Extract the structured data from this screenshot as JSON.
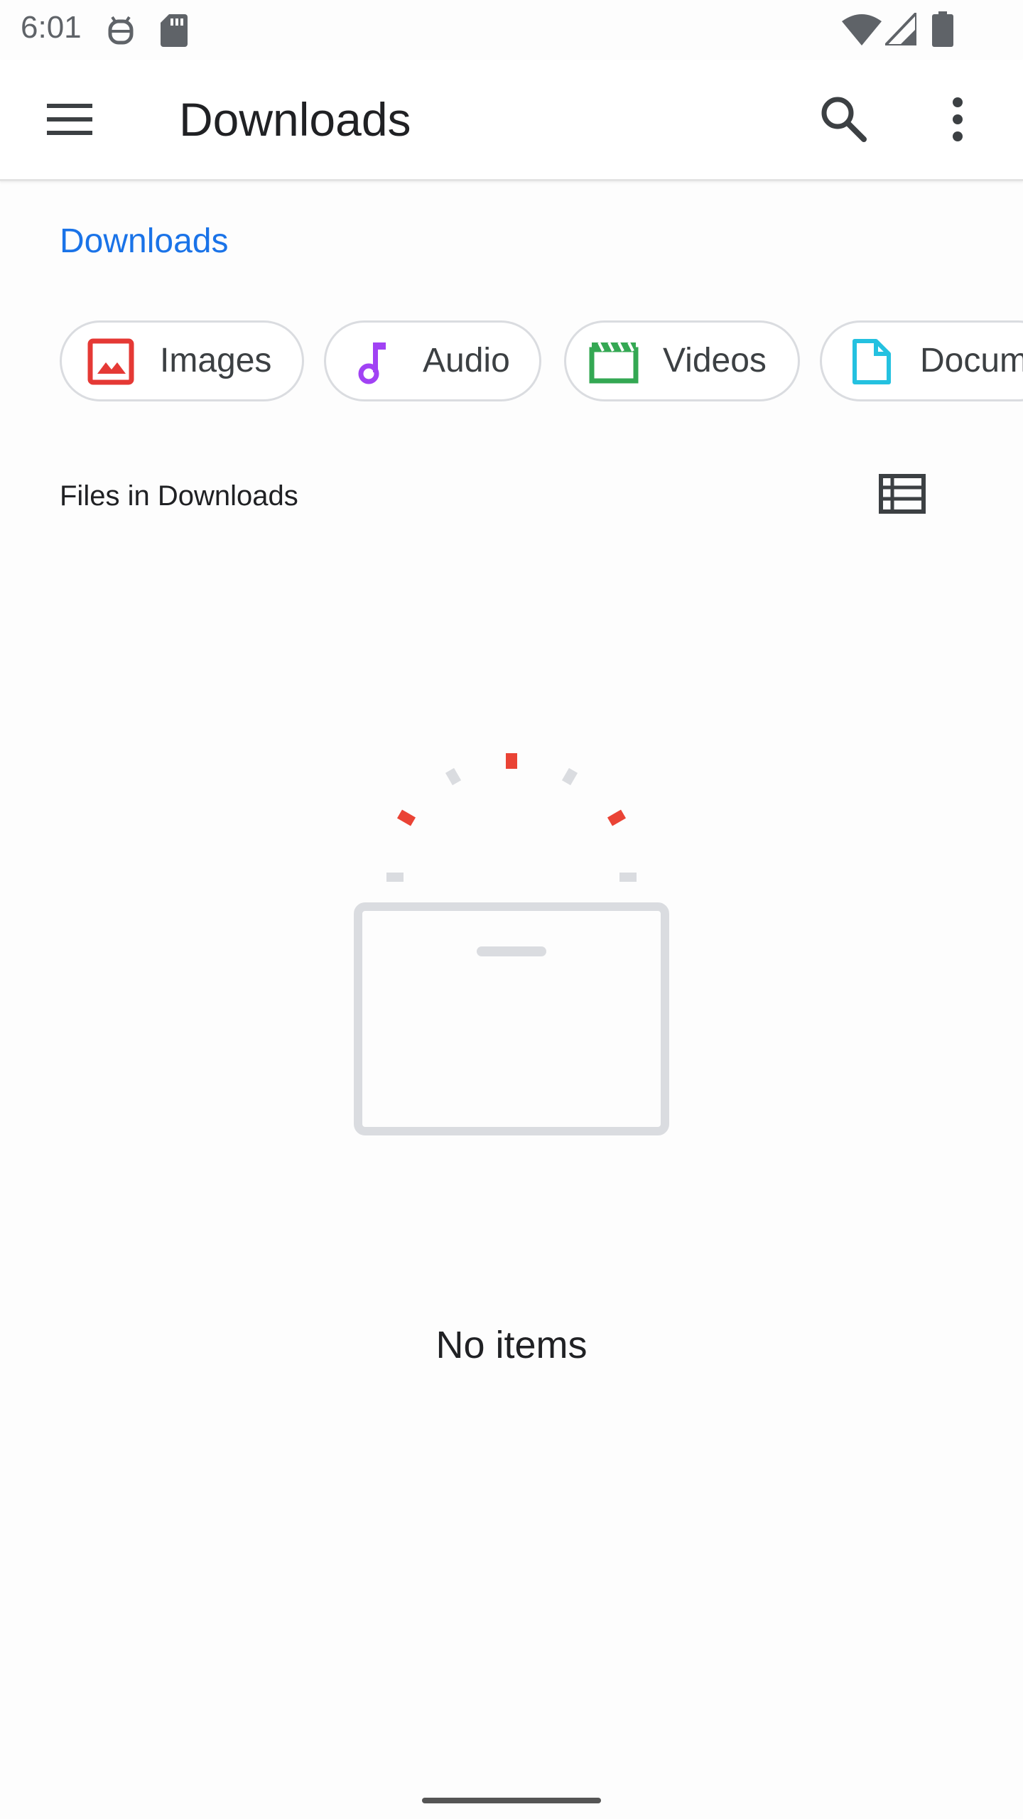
{
  "status_bar": {
    "time": "6:01",
    "icons": [
      "android-debug-icon",
      "sd-card-icon",
      "wifi-icon",
      "signal-icon",
      "battery-icon"
    ]
  },
  "app_bar": {
    "title": "Downloads",
    "menu_icon": "menu-icon",
    "search_icon": "search-icon",
    "more_icon": "more-vert-icon"
  },
  "breadcrumb": {
    "current": "Downloads"
  },
  "chips": [
    {
      "label": "Images",
      "icon": "image-icon",
      "color": "#e53935"
    },
    {
      "label": "Audio",
      "icon": "music-note-icon",
      "color": "#a142f4"
    },
    {
      "label": "Videos",
      "icon": "movie-icon",
      "color": "#34a853"
    },
    {
      "label": "Documents",
      "icon": "document-icon",
      "color": "#24c1e0"
    }
  ],
  "section": {
    "title": "Files in Downloads",
    "view_toggle_icon": "list-view-icon"
  },
  "empty_state": {
    "message": "No items",
    "accent_color": "#ea4335",
    "muted_color": "#dadce0"
  }
}
